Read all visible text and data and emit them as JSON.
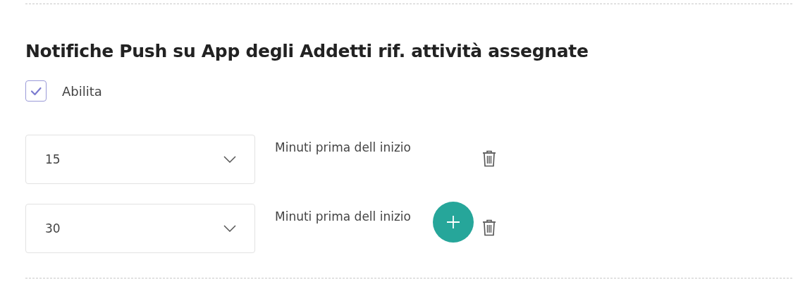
{
  "section": {
    "title": "Notifiche Push su App degli Addetti rif. attività assegnate"
  },
  "enable": {
    "label": "Abilita",
    "checked": true
  },
  "reminders": [
    {
      "value": "15",
      "label": "Minuti prima dell inizio"
    },
    {
      "value": "30",
      "label": "Minuti prima dell inizio"
    }
  ]
}
